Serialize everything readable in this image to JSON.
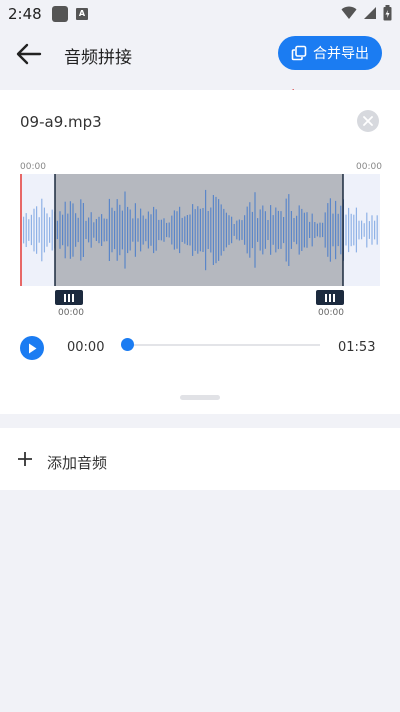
{
  "status": {
    "time": "2:48"
  },
  "header": {
    "title": "音频拼接",
    "export_label": "合并导出"
  },
  "clip": {
    "file_name": "09-a9.mp3",
    "wave_start_time": "00:00",
    "wave_end_time": "00:00",
    "handle_left_time": "00:00",
    "handle_right_time": "00:00"
  },
  "player": {
    "current_time": "00:00",
    "total_time": "01:53",
    "progress": 0.0
  },
  "add_audio": {
    "label": "添加音频"
  },
  "colors": {
    "accent": "#1b7cf2",
    "annotation": "#d32020",
    "selection": "#b5b8bf",
    "wave": "#5b8fd6"
  },
  "icons": [
    "back-arrow-icon",
    "export-merge-icon",
    "close-icon",
    "play-icon",
    "plus-icon"
  ]
}
